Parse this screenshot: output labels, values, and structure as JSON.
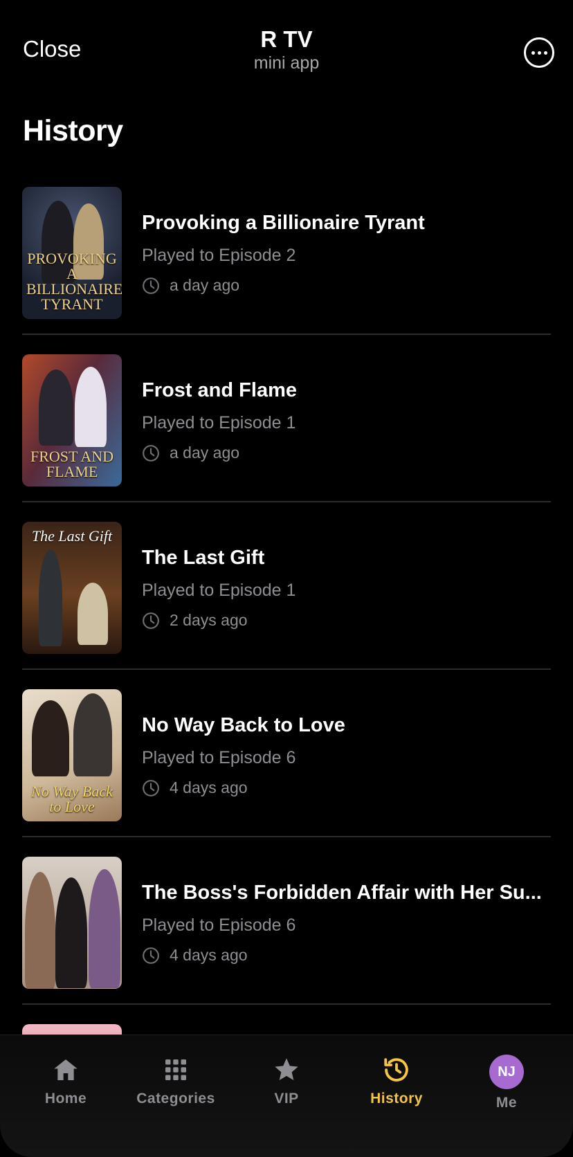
{
  "header": {
    "close_label": "Close",
    "app_title": "R TV",
    "app_subtitle": "mini app",
    "more_icon": "more-horizontal-circle-icon"
  },
  "page_title": "History",
  "items": [
    {
      "title": "Provoking a Billionaire Tyrant",
      "episode": "Played to Episode 2",
      "time": "a day ago",
      "cover_text": "PROVOKING A BILLIONAIRE TYRANT"
    },
    {
      "title": "Frost and Flame",
      "episode": "Played to Episode 1",
      "time": "a day ago",
      "cover_text": "FROST AND FLAME"
    },
    {
      "title": "The Last Gift",
      "episode": "Played to Episode 1",
      "time": "2 days ago",
      "cover_text": "The Last Gift"
    },
    {
      "title": "No Way Back to Love",
      "episode": "Played to Episode 6",
      "time": "4 days ago",
      "cover_text": "No Way Back to Love"
    },
    {
      "title": "The Boss's Forbidden Affair with Her Su...",
      "episode": "Played to Episode 6",
      "time": "4 days ago",
      "cover_text": ""
    }
  ],
  "tabs": [
    {
      "label": "Home",
      "icon": "home-icon",
      "active": false
    },
    {
      "label": "Categories",
      "icon": "grid-icon",
      "active": false
    },
    {
      "label": "VIP",
      "icon": "star-icon",
      "active": false
    },
    {
      "label": "History",
      "icon": "history-icon",
      "active": true
    },
    {
      "label": "Me",
      "icon": "avatar",
      "active": false,
      "avatar_text": "NJ"
    }
  ],
  "colors": {
    "accent": "#f4c542",
    "avatar_bg": "#a76ad0",
    "muted_text": "#8e8e93"
  }
}
